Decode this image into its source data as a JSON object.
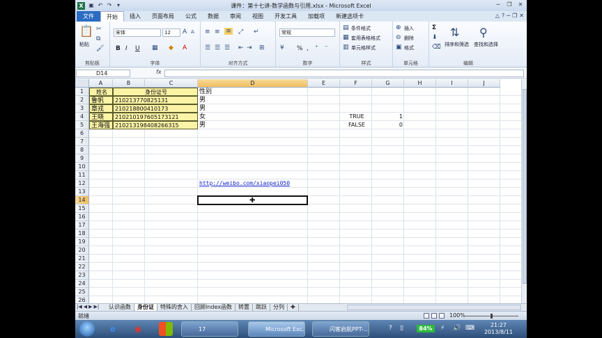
{
  "window": {
    "title": "课件：第十七讲-数学函数与引用.xlsx - Microsoft Excel",
    "app_icon": "X"
  },
  "tabs": [
    {
      "label": "文件"
    },
    {
      "label": "开始"
    },
    {
      "label": "插入"
    },
    {
      "label": "页面布局"
    },
    {
      "label": "公式"
    },
    {
      "label": "数据"
    },
    {
      "label": "审阅"
    },
    {
      "label": "视图"
    },
    {
      "label": "开发工具"
    },
    {
      "label": "加载项"
    },
    {
      "label": "新建选项卡"
    }
  ],
  "ribbon": {
    "clipboard": {
      "paste": "粘贴",
      "label": "剪贴板"
    },
    "font": {
      "name": "宋体",
      "size": "12",
      "label": "字体",
      "bold": "B",
      "italic": "I",
      "underline": "U"
    },
    "alignment": {
      "label": "对齐方式"
    },
    "number": {
      "format": "常规",
      "label": "数字",
      "percent": "%",
      "comma": ","
    },
    "styles": {
      "cond": "条件格式",
      "table": "套用表格格式",
      "cell": "单元格样式",
      "label": "样式"
    },
    "cells": {
      "insert": "插入",
      "delete": "删除",
      "format": "格式",
      "label": "单元格"
    },
    "editing": {
      "sigma": "Σ",
      "sort": "排序和筛选",
      "find": "查找和选择",
      "label": "编辑"
    }
  },
  "formula_bar": {
    "name_box": "D14",
    "fx": "fx",
    "value": ""
  },
  "columns": [
    "A",
    "B",
    "C",
    "D",
    "E",
    "F",
    "G",
    "H",
    "I",
    "J"
  ],
  "rows": [
    "1",
    "2",
    "3",
    "4",
    "5",
    "6",
    "7",
    "8",
    "9",
    "10",
    "11",
    "12",
    "13",
    "14",
    "15",
    "16",
    "17",
    "18",
    "19",
    "20",
    "21",
    "22",
    "23",
    "24",
    "25",
    "26"
  ],
  "cells": {
    "A1": "姓名",
    "B1": "身份证号",
    "D1": "性别",
    "A2": "鲁帆",
    "B2": "210213770825131",
    "D2": "男",
    "A3": "章戎",
    "B3": "210218800410173",
    "D3": "男",
    "A4": "王晓",
    "B4": "210210197605173121",
    "D4": "女",
    "A5": "王海强",
    "B5": "210213198408266315",
    "D5": "男",
    "F4": "TRUE",
    "G4": "1",
    "F5": "FALSE",
    "G5": "0",
    "D12": "http://weibo.com/xiaopei050"
  },
  "sheets": [
    {
      "label": "认识函数"
    },
    {
      "label": "身份证"
    },
    {
      "label": "特殊的舍入"
    },
    {
      "label": "回顾Index函数"
    },
    {
      "label": "转置"
    },
    {
      "label": "跳跃"
    },
    {
      "label": "分列"
    }
  ],
  "status": {
    "ready": "就绪",
    "zoom": "100%"
  },
  "taskbar": {
    "folder_task": "17",
    "excel_task": "Microsoft Exc...",
    "ppt_task": "闪客启航PPT-...",
    "battery": "84%",
    "time": "21:27",
    "date": "2013/8/11"
  }
}
